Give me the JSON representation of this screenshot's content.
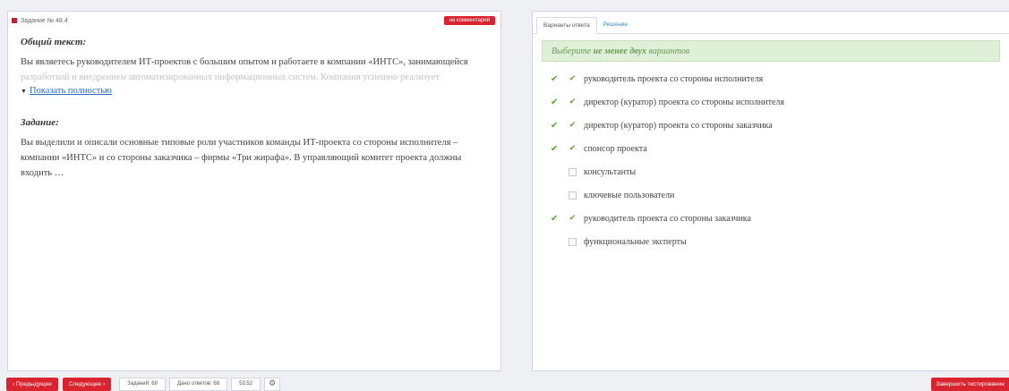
{
  "left": {
    "task_label": "Задание № 48.4",
    "comment_button": "на комментарий",
    "common_text_title": "Общий текст:",
    "common_text": "Вы являетесь руководителем ИТ-проектов с большим опытом и работаете в компании «ИНТС», занимающейся",
    "common_text_faded": "разработкой и внедрением автоматизированных информационных систем. Компания успешно реализует",
    "show_full_link": "Показать полностью",
    "task_title": "Задание:",
    "task_text": "Вы выделили и описали основные типовые роли участников команды ИТ-проекта со стороны исполнителя – компании «ИНТС» и со стороны заказчика – фирмы «Три жирафа». В управляющий комитет проекта должны входить …"
  },
  "right": {
    "tabs": [
      {
        "label": "Варианты ответа"
      },
      {
        "label": "Решение"
      }
    ],
    "notice_before": "Выберите",
    "notice_bold": "не менее двух",
    "notice_after": "вариантов",
    "options": [
      {
        "label": "руководитель проекта со стороны исполнителя",
        "checked": true
      },
      {
        "label": "директор (куратор) проекта со стороны исполнителя",
        "checked": true
      },
      {
        "label": "директор (куратор) проекта со стороны заказчика",
        "checked": true
      },
      {
        "label": "спонсор проекта",
        "checked": true
      },
      {
        "label": "консультанты",
        "checked": false
      },
      {
        "label": "ключевые пользователи",
        "checked": false
      },
      {
        "label": "руководитель проекта со стороны заказчика",
        "checked": true
      },
      {
        "label": "функциональные эксперты",
        "checked": false
      }
    ]
  },
  "footer": {
    "prev_button": "‹ Предыдущее",
    "next_button": "Следующее ›",
    "tasks_count": "Заданий: 68",
    "answers_count": "Дано ответов: 68",
    "timer": "53:52",
    "finish_button": "Завершить тестирование"
  },
  "colors": {
    "accent_red": "#d9242f",
    "check_green": "#5aa62e",
    "notice_bg": "#dff0d8",
    "link_blue": "#2a6ac0"
  },
  "icons": {
    "settings": "gear-icon",
    "checked": "check-icon",
    "expand": "chevron-down-icon"
  }
}
